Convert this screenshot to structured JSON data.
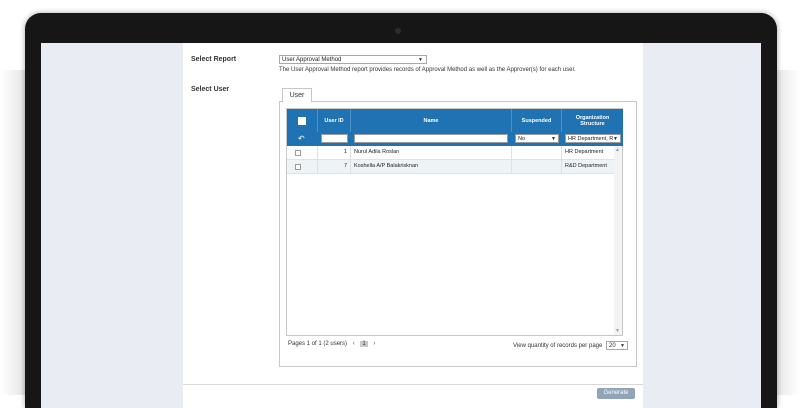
{
  "form": {
    "select_report_label": "Select Report",
    "report_value": "User Approval Method",
    "report_description": "The User Approval Method report provides records of Approval Method as well as the Approver(s) for each user.",
    "select_user_label": "Select User"
  },
  "tab": {
    "label": "User"
  },
  "table": {
    "headers": {
      "user_id": "User ID",
      "name": "Name",
      "suspended": "Suspended",
      "org_structure": "Organization Structure"
    },
    "filters": {
      "suspended_value": "No",
      "org_value": "HR Department, R"
    },
    "rows": [
      {
        "user_id": "1",
        "name": "Nurul Adila Roslan",
        "suspended": "",
        "org": "HR Department"
      },
      {
        "user_id": "7",
        "name": "Koshella A/P Balakrisknan",
        "suspended": "",
        "org": "R&D Department"
      }
    ]
  },
  "pager": {
    "info": "Pages 1 of 1 (2 users)",
    "prev": "‹",
    "current": "1",
    "next": "›",
    "qty_label": "View quantity of records per page",
    "qty_value": "20"
  },
  "footer": {
    "generate_label": "Generate"
  },
  "icons": {
    "reset": "undo-icon",
    "caret": "chevron-down-icon"
  },
  "colors": {
    "header_blue": "#1f73b2",
    "button": "#8fa4b6"
  }
}
